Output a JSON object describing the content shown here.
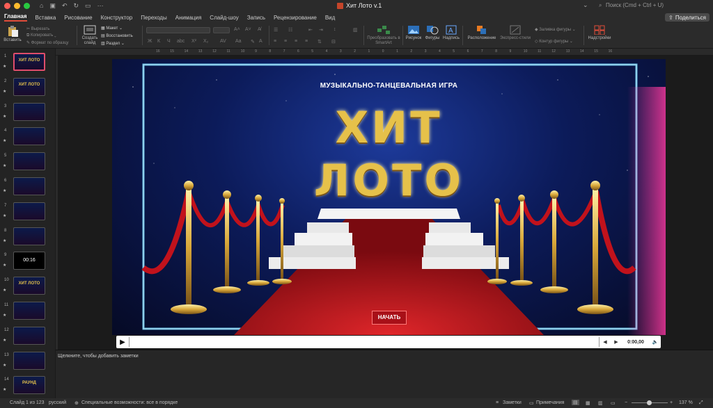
{
  "window": {
    "title": "Хит Лото v.1",
    "search_placeholder": "Поиск (Cmd + Ctrl + U)"
  },
  "tabs": [
    "Главная",
    "Вставка",
    "Рисование",
    "Конструктор",
    "Переходы",
    "Анимация",
    "Слайд-шоу",
    "Запись",
    "Рецензирование",
    "Вид"
  ],
  "share_label": "Поделиться",
  "ribbon": {
    "paste": "Вставить",
    "cut": "Вырезать",
    "copy": "Копировать",
    "format": "Формат по образцу",
    "new_slide": "Создать слайд",
    "layout": "Макет",
    "reset": "Восстановить",
    "section": "Раздел",
    "smartart": "Преобразовать в SmartArt",
    "picture": "Рисунок",
    "shapes": "Фигуры",
    "textbox": "Надпись",
    "arrange": "Расположение",
    "express": "Экспресс-стили",
    "fill": "Заливка фигуры",
    "outline": "Контур фигуры",
    "addins": "Надстройки"
  },
  "ruler_marks": [
    "16",
    "15",
    "14",
    "13",
    "12",
    "11",
    "10",
    "9",
    "8",
    "7",
    "6",
    "5",
    "4",
    "3",
    "2",
    "1",
    "0",
    "1",
    "2",
    "3",
    "4",
    "5",
    "6",
    "7",
    "8",
    "9",
    "10",
    "11",
    "12",
    "13",
    "14",
    "15",
    "16"
  ],
  "thumbnails": [
    {
      "num": "1",
      "text": "ХИТ ЛОТО"
    },
    {
      "num": "2",
      "text": "ХИТ ЛОТО"
    },
    {
      "num": "3",
      "text": ""
    },
    {
      "num": "4",
      "text": ""
    },
    {
      "num": "5",
      "text": ""
    },
    {
      "num": "6",
      "text": ""
    },
    {
      "num": "7",
      "text": ""
    },
    {
      "num": "8",
      "text": ""
    },
    {
      "num": "9",
      "text": "00:16"
    },
    {
      "num": "10",
      "text": "ХИТ ЛОТО"
    },
    {
      "num": "11",
      "text": ""
    },
    {
      "num": "12",
      "text": ""
    },
    {
      "num": "13",
      "text": ""
    },
    {
      "num": "14",
      "text": "РАУНД"
    }
  ],
  "slide": {
    "subtitle": "МУЗЫКАЛЬНО-ТАНЦЕВАЛЬНАЯ ИГРА",
    "title_line1": "ХИТ",
    "title_line2": "ЛОТО",
    "start_button": "НАЧАТЬ"
  },
  "media": {
    "time": "0:00,00"
  },
  "notes_placeholder": "Щелкните, чтобы добавить заметки",
  "status": {
    "slide_counter": "Слайд 1 из 123",
    "language": "русский",
    "accessibility": "Специальные возможности: все в порядке",
    "notes": "Заметки",
    "comments": "Примечания",
    "zoom": "137 %"
  },
  "colors": {
    "accent": "#e14c3a",
    "gold": "#e6c14a",
    "carpet": "#b3151c"
  }
}
